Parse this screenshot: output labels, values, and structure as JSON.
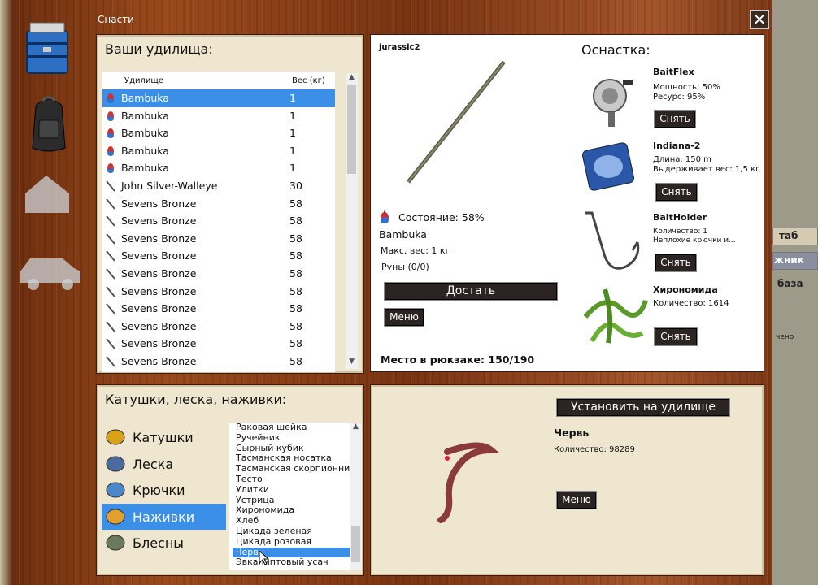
{
  "window": {
    "title": "Снасти",
    "close_label": "✕"
  },
  "rods_panel": {
    "header": "Ваши удилища:",
    "columns": [
      "Удилище",
      "Вес (кг)"
    ],
    "rows": [
      {
        "name": "Bambuka",
        "weight": "1",
        "icon": "float-icon",
        "selected": true
      },
      {
        "name": "Bambuka",
        "weight": "1",
        "icon": "float-icon"
      },
      {
        "name": "Bambuka",
        "weight": "1",
        "icon": "float-icon"
      },
      {
        "name": "Bambuka",
        "weight": "1",
        "icon": "float-icon"
      },
      {
        "name": "Bambuka",
        "weight": "1",
        "icon": "float-icon"
      },
      {
        "name": "John Silver-Walleye",
        "weight": "30",
        "icon": "spinning-rod-icon"
      },
      {
        "name": "Sevens Bronze",
        "weight": "58",
        "icon": "spinning-rod-icon"
      },
      {
        "name": "Sevens Bronze",
        "weight": "58",
        "icon": "spinning-rod-icon"
      },
      {
        "name": "Sevens Bronze",
        "weight": "58",
        "icon": "spinning-rod-icon"
      },
      {
        "name": "Sevens Bronze",
        "weight": "58",
        "icon": "spinning-rod-icon"
      },
      {
        "name": "Sevens Bronze",
        "weight": "58",
        "icon": "spinning-rod-icon"
      },
      {
        "name": "Sevens Bronze",
        "weight": "58",
        "icon": "spinning-rod-icon"
      },
      {
        "name": "Sevens Bronze",
        "weight": "58",
        "icon": "spinning-rod-icon"
      },
      {
        "name": "Sevens Bronze",
        "weight": "58",
        "icon": "spinning-rod-icon"
      },
      {
        "name": "Sevens Bronze",
        "weight": "58",
        "icon": "spinning-rod-icon"
      },
      {
        "name": "Sevens Bronze",
        "weight": "58",
        "icon": "spinning-rod-icon"
      }
    ]
  },
  "rod_detail": {
    "owner": "jurassic2",
    "condition": "Состояние: 58%",
    "name": "Bambuka",
    "max_weight": "Макс. вес: 1 кг",
    "runes": "Руны (0/0)",
    "take_button": "Достать",
    "menu_button": "Меню",
    "backpack": "Место в рюкзаке: 150/190"
  },
  "rigging": {
    "header": "Оснастка:",
    "remove_label": "Снять",
    "items": [
      {
        "name": "BaitFlex",
        "lines": [
          "Мощность: 50%",
          "Ресурс: 95%"
        ],
        "icon": "reel-icon"
      },
      {
        "name": "Indiana-2",
        "lines": [
          "Длина: 150 m",
          "Выдерживает вес: 1,5 кг"
        ],
        "icon": "fishing-line-icon"
      },
      {
        "name": "BaitHolder",
        "lines": [
          "Количество: 1",
          "Неплохие крючки и..."
        ],
        "icon": "hook-icon"
      },
      {
        "name": "Хирономида",
        "lines": [
          "Количество: 1614"
        ],
        "icon": "bloodworm-icon"
      }
    ]
  },
  "tackle_panel": {
    "header": "Катушки, леска, наживки:",
    "categories": [
      {
        "label": "Катушки",
        "icon": "reel-icon"
      },
      {
        "label": "Леска",
        "icon": "line-spool-icon"
      },
      {
        "label": "Крючки",
        "icon": "hooks-icon"
      },
      {
        "label": "Наживки",
        "icon": "bait-icon",
        "selected": true
      },
      {
        "label": "Блесны",
        "icon": "lure-icon"
      }
    ],
    "baits": [
      "Раковая шейка",
      "Ручейник",
      "Сырный кубик",
      "Тасманская носатка",
      "Тасманская скорпионница",
      "Тесто",
      "Улитки",
      "Устрица",
      "Хирономида",
      "Хлеб",
      "Цикада зеленая",
      "Цикада розовая",
      "Червь",
      "Эвкалиптовый усач"
    ],
    "selected_bait": "Червь"
  },
  "bait_detail": {
    "install_button": "Установить на удилище",
    "name": "Червь",
    "quantity": "Количество: 98289",
    "menu_button": "Меню"
  },
  "background": {
    "right_labels": [
      "таб",
      "жник",
      "база",
      "чено"
    ]
  },
  "colors": {
    "selection": "#3b8fe6",
    "panel": "#efe6cf",
    "button": "#2b2422",
    "wood": "#8a3f17"
  }
}
